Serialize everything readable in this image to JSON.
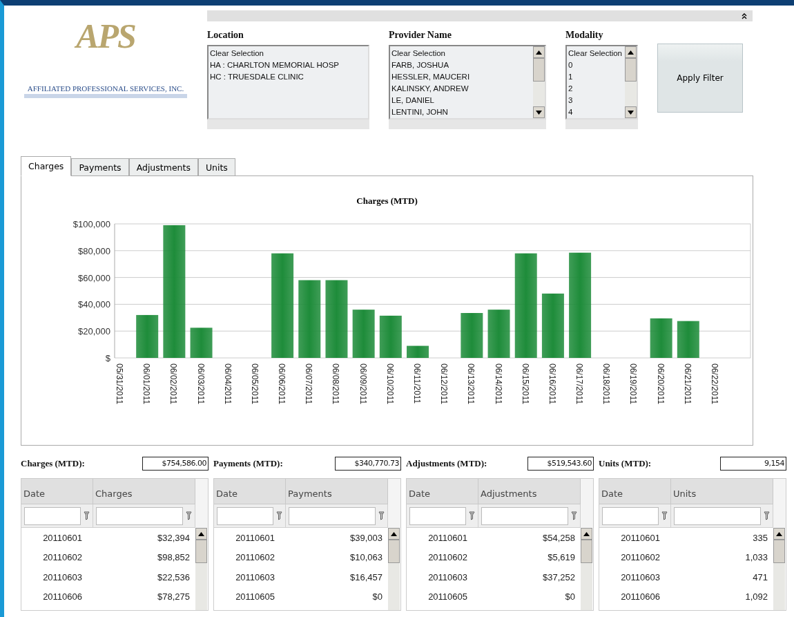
{
  "logo": {
    "mark": "APS",
    "company": "AFFILIATED PROFESSIONAL SERVICES, INC."
  },
  "filters": [
    {
      "label": "Location",
      "scrollbar": false,
      "items": [
        "Clear Selection",
        "HA : CHARLTON MEMORIAL HOSP",
        "HC : TRUESDALE CLINIC"
      ]
    },
    {
      "label": "Provider Name",
      "scrollbar": true,
      "items": [
        "Clear Selection",
        "FARB, JOSHUA",
        "HESSLER, MAUCERI",
        "KALINSKY, ANDREW",
        "LE, DANIEL",
        "LENTINI, JOHN"
      ]
    },
    {
      "label": "Modality",
      "scrollbar": true,
      "items": [
        "Clear Selection",
        "0",
        "1",
        "2",
        "3",
        "4"
      ]
    }
  ],
  "apply_button": "Apply Filter",
  "tabs": [
    {
      "label": "Charges",
      "selected": true
    },
    {
      "label": "Payments",
      "selected": false
    },
    {
      "label": "Adjustments",
      "selected": false
    },
    {
      "label": "Units",
      "selected": false
    }
  ],
  "chart": {
    "chart_data": {
      "type": "bar",
      "title": "Charges (MTD)",
      "categories": [
        "05/31/2011",
        "06/01/2011",
        "06/02/2011",
        "06/03/2011",
        "06/04/2011",
        "06/05/2011",
        "06/06/2011",
        "06/07/2011",
        "06/08/2011",
        "06/09/2011",
        "06/10/2011",
        "06/11/2011",
        "06/12/2011",
        "06/13/2011",
        "06/14/2011",
        "06/15/2011",
        "06/16/2011",
        "06/17/2011",
        "06/18/2011",
        "06/19/2011",
        "06/20/2011",
        "06/21/2011",
        "06/22/2011"
      ],
      "series": [
        {
          "color": "#1e8c3a",
          "values": [
            null,
            32000,
            99000,
            22500,
            0,
            0,
            78000,
            58000,
            58000,
            36000,
            31500,
            9000,
            0,
            33500,
            36000,
            78000,
            48000,
            78500,
            0,
            0,
            29500,
            27500,
            null
          ]
        }
      ],
      "grid": true,
      "ylim": [
        0,
        100000
      ],
      "yticks": [
        {
          "value": 0,
          "label": "$"
        },
        {
          "value": 20000,
          "label": "$20,000"
        },
        {
          "value": 40000,
          "label": "$40,000"
        },
        {
          "value": 60000,
          "label": "$60,000"
        },
        {
          "value": 80000,
          "label": "$80,000"
        },
        {
          "value": 100000,
          "label": "$100,000"
        }
      ]
    }
  },
  "summaries": [
    {
      "label": "Charges (MTD):",
      "total": "$754,586.00",
      "columns": [
        "Date",
        "Charges"
      ],
      "rows": [
        [
          "20110601",
          "$32,394"
        ],
        [
          "20110602",
          "$98,852"
        ],
        [
          "20110603",
          "$22,536"
        ],
        [
          "20110606",
          "$78,275"
        ]
      ]
    },
    {
      "label": "Payments (MTD):",
      "total": "$340,770.73",
      "columns": [
        "Date",
        "Payments"
      ],
      "rows": [
        [
          "20110601",
          "$39,003"
        ],
        [
          "20110602",
          "$10,063"
        ],
        [
          "20110603",
          "$16,457"
        ],
        [
          "20110605",
          "$0"
        ]
      ]
    },
    {
      "label": "Adjustments (MTD):",
      "total": "$519,543.60",
      "columns": [
        "Date",
        "Adjustments"
      ],
      "rows": [
        [
          "20110601",
          "$54,258"
        ],
        [
          "20110602",
          "$5,619"
        ],
        [
          "20110603",
          "$37,252"
        ],
        [
          "20110605",
          "$0"
        ]
      ]
    },
    {
      "label": "Units (MTD):",
      "total": "9,154",
      "columns": [
        "Date",
        "Units"
      ],
      "rows": [
        [
          "20110601",
          "335"
        ],
        [
          "20110602",
          "1,033"
        ],
        [
          "20110603",
          "471"
        ],
        [
          "20110606",
          "1,092"
        ]
      ]
    }
  ]
}
